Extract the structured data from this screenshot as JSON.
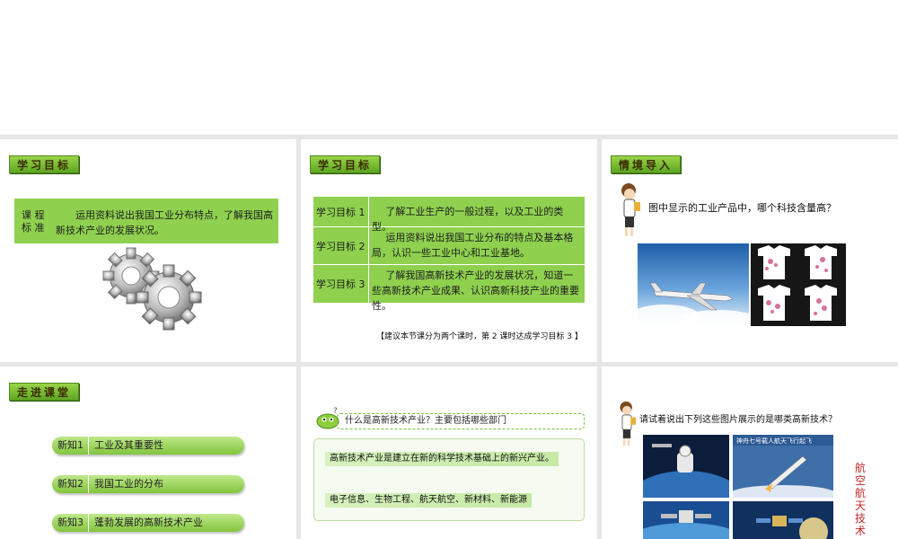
{
  "slide1": {
    "tag": "学习目标",
    "standard_label": "课 程 标 准",
    "standard_text": "运用资料说出我国工业分布特点，了解我国高新技术产业的发展状况。"
  },
  "slide2": {
    "tag": "学习目标",
    "goals": [
      {
        "label": "学习目标 1",
        "text": "了解工业生产的一般过程，以及工业的类型。"
      },
      {
        "label": "学习目标 2",
        "text": "运用资料说出我国工业分布的特点及基本格局，认识一些工业中心和工业基地。"
      },
      {
        "label": "学习目标 3",
        "text": "了解我国高新技术产业的发展状况，知道一些高新技术产业成果、认识高新科技产业的重要性。"
      }
    ],
    "note": "【建议本节课分为两个课时，第 2 课时达成学习目标 3 】"
  },
  "slide3": {
    "tag": "情境导入",
    "question": "图中显示的工业产品中，哪个科技含量高？"
  },
  "slide4": {
    "tag": "走进课堂",
    "items": [
      {
        "num": "新知1",
        "text": "工业及其重要性"
      },
      {
        "num": "新知2",
        "text": "我国工业的分布"
      },
      {
        "num": "新知3",
        "text": "蓬勃发展的高新技术产业"
      }
    ]
  },
  "slide5": {
    "question": "什么是高新技术产业？主要包括哪些部门",
    "answer1": "高新技术产业是建立在新的科学技术基础上的新兴产业。",
    "answer2": "电子信息、生物工程、航天航空、新材料、新能源"
  },
  "slide6": {
    "question": "请试着说出下列这些图片展示的是哪类高新技术？",
    "image_caption": "神舟七号载人航天飞行起飞",
    "answer_vertical": "航空航天技术"
  },
  "colors": {
    "accent_green": "#8fd14f",
    "tag_green": "#6fb52c",
    "answer_red": "#c62828"
  }
}
